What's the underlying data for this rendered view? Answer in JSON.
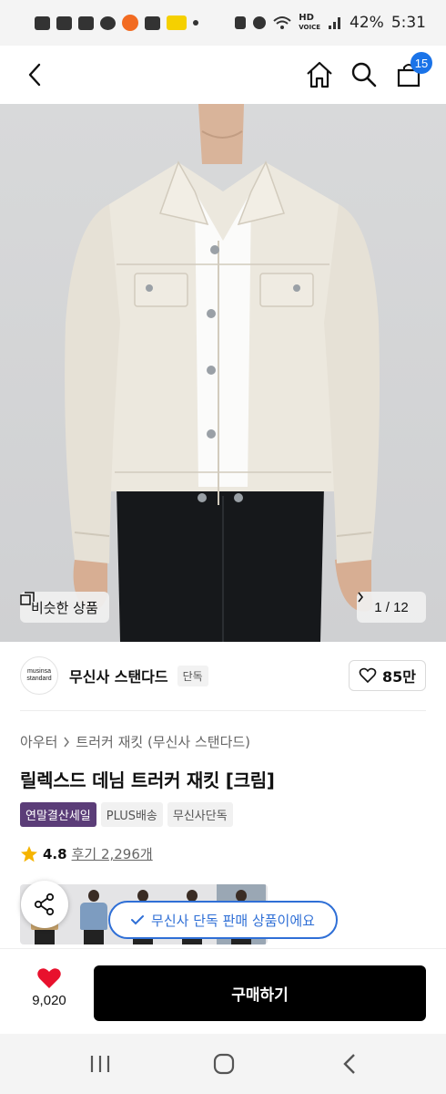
{
  "status_bar": {
    "battery": "42%",
    "time": "5:31",
    "network_label": "HD",
    "network_sublabel": "VOICE"
  },
  "nav": {
    "cart_count": "15"
  },
  "hero": {
    "similar_label": "비슷한 상품",
    "pager_label": "1 / 12"
  },
  "brand": {
    "logo_line1": "musinsa",
    "logo_line2": "standard",
    "name": "무신사 스탠다드",
    "tag": "단독",
    "likes": "85만"
  },
  "breadcrumb": {
    "category": "아우터",
    "sub": "트러커 재킷 (무신사 스탠다드)"
  },
  "product": {
    "title": "릴렉스드 데님 트러커 재킷 [크림]",
    "tags": [
      "연말결산세일",
      "PLUS배송",
      "무신사단독"
    ],
    "rating": "4.8",
    "review_label": "후기 2,296개"
  },
  "toast": {
    "text": "무신사 단독 판매 상품이에요"
  },
  "buy_bar": {
    "wish_count": "9,020",
    "buy_label": "구매하기"
  },
  "colors": {
    "accent": "#2f6fd6",
    "badge": "#1a73e8",
    "sale_tag": "#5b3d78",
    "heart": "#e8112d",
    "star": "#f5b400"
  }
}
